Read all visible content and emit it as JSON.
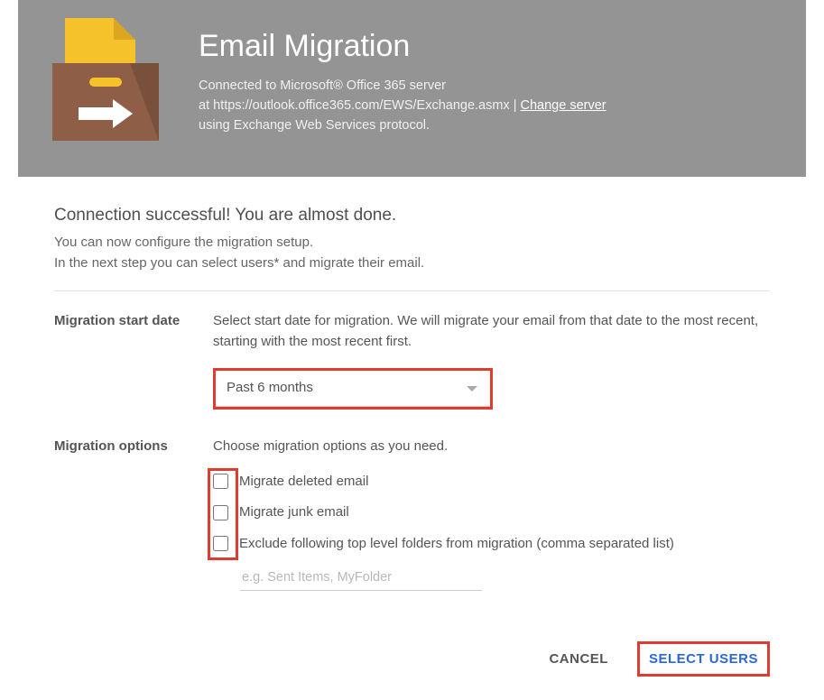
{
  "hero": {
    "title": "Email Migration",
    "line1": "Connected to Microsoft® Office 365 server",
    "line2_prefix": "at https://outlook.office365.com/EWS/Exchange.asmx | ",
    "change_server": "Change server",
    "line3": "using Exchange Web Services protocol."
  },
  "status": {
    "headline": "Connection successful! You are almost done.",
    "sub1": "You can now configure the migration setup.",
    "sub2": "In the next step you can select users* and migrate their email."
  },
  "start_date": {
    "label": "Migration start date",
    "desc": "Select start date for migration. We will migrate your email from that date to the most recent, starting with the most recent first.",
    "selected": "Past 6 months"
  },
  "options": {
    "label": "Migration options",
    "desc": "Choose migration options as you need.",
    "opt_deleted": "Migrate deleted email",
    "opt_junk": "Migrate junk email",
    "opt_exclude": "Exclude following top level folders from migration (comma separated list)",
    "exclude_placeholder": "e.g. Sent Items, MyFolder"
  },
  "footer": {
    "cancel": "CANCEL",
    "select_users": "SELECT USERS"
  }
}
